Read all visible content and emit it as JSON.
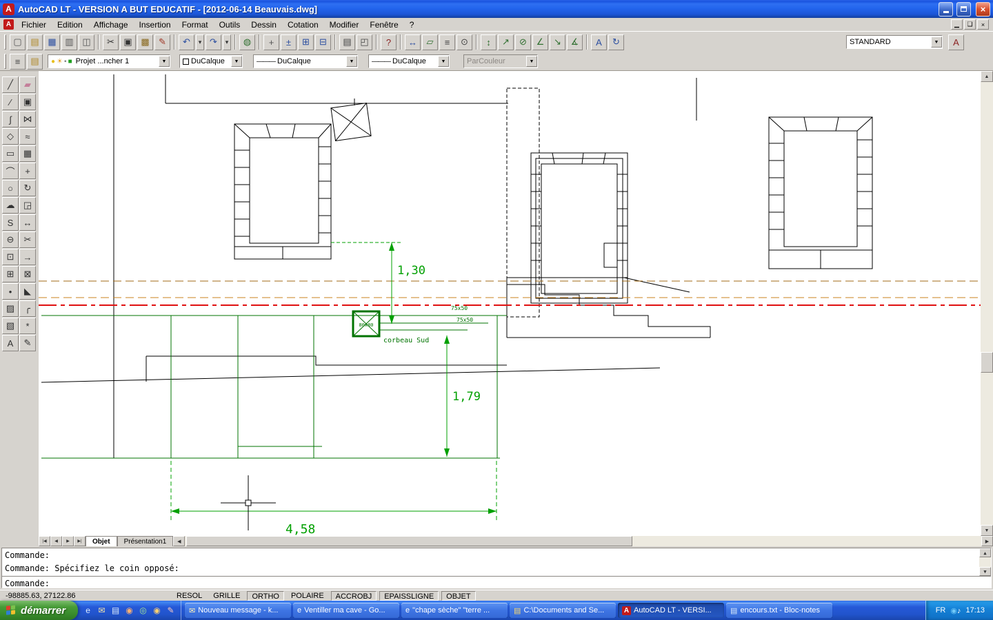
{
  "titlebar": {
    "title": "AutoCAD LT - VERSION A BUT EDUCATIF - [2012-06-14 Beauvais.dwg]"
  },
  "menubar": {
    "items": [
      "Fichier",
      "Edition",
      "Affichage",
      "Insertion",
      "Format",
      "Outils",
      "Dessin",
      "Cotation",
      "Modifier",
      "Fenêtre",
      "?"
    ]
  },
  "toolbar_main": {
    "style_value": "STANDARD",
    "right_button": {
      "glyph": "A"
    },
    "buttons": [
      {
        "name": "new-icon",
        "glyph": "▢",
        "color": "#555555"
      },
      {
        "name": "open-icon",
        "glyph": "▤",
        "color": "#B08A2A"
      },
      {
        "name": "save-icon",
        "glyph": "▦",
        "color": "#2B4EA0"
      },
      {
        "name": "print-icon",
        "glyph": "▥",
        "color": "#555555"
      },
      {
        "name": "print-preview-icon",
        "glyph": "◫",
        "color": "#555555"
      },
      {
        "sep": true
      },
      {
        "name": "cut-icon",
        "glyph": "✂",
        "color": "#333333"
      },
      {
        "name": "copy-icon",
        "glyph": "▣",
        "color": "#333333"
      },
      {
        "name": "paste-icon",
        "glyph": "▩",
        "color": "#8A6A20"
      },
      {
        "name": "match-properties-icon",
        "glyph": "✎",
        "color": "#A03828"
      },
      {
        "sep": true
      },
      {
        "name": "undo-icon",
        "glyph": "↶",
        "color": "#2B4EA0"
      },
      {
        "name": "undo-list-icon",
        "glyph": "▾",
        "color": "#333333",
        "narrow": true
      },
      {
        "name": "redo-icon",
        "glyph": "↷",
        "color": "#2B4EA0"
      },
      {
        "name": "redo-list-icon",
        "glyph": "▾",
        "color": "#333333",
        "narrow": true
      },
      {
        "sep": true
      },
      {
        "name": "insert-hyperlink-icon",
        "glyph": "◍",
        "color": "#2F6F2F"
      },
      {
        "sep": true
      },
      {
        "name": "pan-realtime-icon",
        "glyph": "+",
        "color": "#555555"
      },
      {
        "name": "zoom-realtime-icon",
        "glyph": "±",
        "color": "#2B4EA0"
      },
      {
        "name": "zoom-window-icon",
        "glyph": "⊞",
        "color": "#2B4EA0"
      },
      {
        "name": "zoom-previous-icon",
        "glyph": "⊟",
        "color": "#2B4EA0"
      },
      {
        "sep": true
      },
      {
        "name": "properties-icon",
        "glyph": "▤",
        "color": "#444444"
      },
      {
        "name": "designcenter-icon",
        "glyph": "◰",
        "color": "#444444"
      },
      {
        "sep": true
      },
      {
        "name": "help-icon",
        "glyph": "?",
        "color": "#8A1F1F"
      },
      {
        "sep": true
      },
      {
        "name": "distance-icon",
        "glyph": "↔",
        "color": "#2B4EA0"
      },
      {
        "name": "area-icon",
        "glyph": "▱",
        "color": "#2F6F2F"
      },
      {
        "name": "list-icon",
        "glyph": "≡",
        "color": "#444444"
      },
      {
        "name": "locate-point-icon",
        "glyph": "⊙",
        "color": "#444444"
      },
      {
        "sep": true
      },
      {
        "name": "dim-linear-icon",
        "glyph": "↕",
        "color": "#2F6F2F"
      },
      {
        "name": "dim-aligned-icon",
        "glyph": "↗",
        "color": "#2F6F2F"
      },
      {
        "name": "dim-radius-icon",
        "glyph": "⊘",
        "color": "#2F6F2F"
      },
      {
        "name": "dim-angular-icon",
        "glyph": "∠",
        "color": "#2F6F2F"
      },
      {
        "name": "dim-leader-icon",
        "glyph": "↘",
        "color": "#2F6F2F"
      },
      {
        "name": "dim-tolerance-icon",
        "glyph": "∡",
        "color": "#2F6F2F"
      },
      {
        "sep": true
      },
      {
        "name": "dim-edit-icon",
        "glyph": "A",
        "color": "#2B4EA0"
      },
      {
        "name": "dim-update-icon",
        "glyph": "↻",
        "color": "#2B4EA0"
      }
    ]
  },
  "toolbar_props": {
    "lead_buttons": [
      {
        "name": "layers-icon",
        "glyph": "≡",
        "color": "#444444"
      },
      {
        "name": "layer-states-icon",
        "glyph": "▤",
        "color": "#B08A2A"
      }
    ],
    "layer_state_icons": [
      {
        "name": "layer-on-icon",
        "glyph": "●",
        "color": "#E8C020"
      },
      {
        "name": "layer-freeze-icon",
        "glyph": "☀",
        "color": "#E8A020"
      },
      {
        "name": "layer-lock-icon",
        "glyph": "▪",
        "color": "#888888"
      },
      {
        "name": "layer-color-icon",
        "glyph": "■",
        "color": "#20A020"
      }
    ],
    "layer": {
      "value": "Projet ...ncher 1"
    },
    "color": {
      "value": "DuCalque"
    },
    "linetype": {
      "value": "DuCalque"
    },
    "lineweight": {
      "value": "DuCalque"
    },
    "plotstyle": {
      "value": "ParCouleur"
    }
  },
  "palette": {
    "tools": [
      {
        "name": "line-tool-icon",
        "glyph": "╱"
      },
      {
        "name": "erase-tool-icon",
        "glyph": "▰",
        "color": "#C47F9A"
      },
      {
        "name": "construction-line-tool-icon",
        "glyph": "∕"
      },
      {
        "name": "copy-tool-icon",
        "glyph": "▣"
      },
      {
        "name": "polyline-tool-icon",
        "glyph": "∫"
      },
      {
        "name": "mirror-tool-icon",
        "glyph": "⋈"
      },
      {
        "name": "polygon-tool-icon",
        "glyph": "◇"
      },
      {
        "name": "offset-tool-icon",
        "glyph": "≈"
      },
      {
        "name": "rectangle-tool-icon",
        "glyph": "▭"
      },
      {
        "name": "array-tool-icon",
        "glyph": "▦"
      },
      {
        "name": "arc-tool-icon",
        "glyph": "⌒"
      },
      {
        "name": "move-tool-icon",
        "glyph": "+"
      },
      {
        "name": "circle-tool-icon",
        "glyph": "○"
      },
      {
        "name": "rotate-tool-icon",
        "glyph": "↻"
      },
      {
        "name": "revision-cloud-tool-icon",
        "glyph": "☁"
      },
      {
        "name": "scale-tool-icon",
        "glyph": "◲"
      },
      {
        "name": "spline-tool-icon",
        "glyph": "S"
      },
      {
        "name": "stretch-tool-icon",
        "glyph": "↔"
      },
      {
        "name": "ellipse-tool-icon",
        "glyph": "⊖"
      },
      {
        "name": "trim-tool-icon",
        "glyph": "✂"
      },
      {
        "name": "insert-block-tool-icon",
        "glyph": "⊡"
      },
      {
        "name": "extend-tool-icon",
        "glyph": "→"
      },
      {
        "name": "make-block-tool-icon",
        "glyph": "⊞"
      },
      {
        "name": "break-tool-icon",
        "glyph": "⊠"
      },
      {
        "name": "point-tool-icon",
        "glyph": "•"
      },
      {
        "name": "chamfer-tool-icon",
        "glyph": "◣"
      },
      {
        "name": "hatch-tool-icon",
        "glyph": "▨"
      },
      {
        "name": "fillet-tool-icon",
        "glyph": "╭"
      },
      {
        "name": "region-tool-icon",
        "glyph": "▧"
      },
      {
        "name": "explode-tool-icon",
        "glyph": "*"
      },
      {
        "name": "mtext-tool-icon",
        "glyph": "A"
      },
      {
        "name": "edit-polyline-tool-icon",
        "glyph": "✎"
      }
    ]
  },
  "canvas": {
    "dim_vertical_1": "1,30",
    "dim_vertical_2": "1,79",
    "dim_horizontal": "4,58",
    "label_corbeau": "corbeau Sud",
    "label_size_1": "75x50",
    "label_size_2": "75x50",
    "label_box": "80x80",
    "colors": {
      "structure": "#007300",
      "dimension": "#00A000",
      "axis1": "#A06A14",
      "axis2": "#C8821E",
      "axis_red": "#E01010"
    }
  },
  "tabs": {
    "nav": [
      "|◀",
      "◀",
      "▶",
      "▶|"
    ],
    "items": [
      {
        "label": "Objet",
        "active": true
      },
      {
        "label": "Présentation1",
        "active": false
      }
    ]
  },
  "command": {
    "history": [
      "Commande:",
      "Commande: Spécifiez le coin opposé:"
    ],
    "current": "Commande:"
  },
  "statusbar": {
    "coords": "-98885.63, 27122.86",
    "toggles": [
      {
        "label": "RESOL",
        "on": false
      },
      {
        "label": "GRILLE",
        "on": false
      },
      {
        "label": "ORTHO",
        "on": true
      },
      {
        "label": "POLAIRE",
        "on": false
      },
      {
        "label": "ACCROBJ",
        "on": true
      },
      {
        "label": "EPAISSLIGNE",
        "on": true
      },
      {
        "label": "OBJET",
        "on": true
      }
    ]
  },
  "taskbar": {
    "start_label": "démarrer",
    "quick_launch": [
      {
        "name": "internet-explorer-icon",
        "glyph": "e",
        "color": "#DCEBFF"
      },
      {
        "name": "outlook-express-icon",
        "glyph": "✉",
        "color": "#F4E6A8"
      },
      {
        "name": "show-desktop-icon",
        "glyph": "▤",
        "color": "#D8E8F8"
      },
      {
        "name": "media-player-icon",
        "glyph": "◉",
        "color": "#FFB070"
      },
      {
        "name": "messenger-icon",
        "glyph": "◎",
        "color": "#A8E890"
      },
      {
        "name": "firefox-icon",
        "glyph": "◉",
        "color": "#FFD070"
      },
      {
        "name": "paint-icon",
        "glyph": "✎",
        "color": "#F8C8C0"
      }
    ],
    "tasks": [
      {
        "label": "Nouveau message - k...",
        "icon": "✉",
        "icon_color": "#FFF2B8",
        "active": false
      },
      {
        "label": "Ventiller ma cave - Go...",
        "icon": "e",
        "icon_color": "#FFFFFF",
        "active": false
      },
      {
        "label": "\"chape sèche\" \"terre ...",
        "icon": "e",
        "icon_color": "#FFFFFF",
        "active": false
      },
      {
        "label": "C:\\Documents and Se...",
        "icon": "▤",
        "icon_color": "#F8D870",
        "active": false
      },
      {
        "label": "AutoCAD LT - VERSI...",
        "icon": "A",
        "icon_color": "#FFFFFF",
        "icon_bg": "#C21B1B",
        "active": true
      },
      {
        "label": "encours.txt - Bloc-notes",
        "icon": "▤",
        "icon_color": "#D8E8F8",
        "active": false
      }
    ],
    "tray": {
      "lang": "FR",
      "icons": [
        {
          "name": "messenger-tray-icon",
          "glyph": "◉",
          "color": "#70C8F8"
        },
        {
          "name": "volume-icon",
          "glyph": "♪",
          "color": "#FFFFFF"
        }
      ],
      "time": "17:13"
    }
  }
}
